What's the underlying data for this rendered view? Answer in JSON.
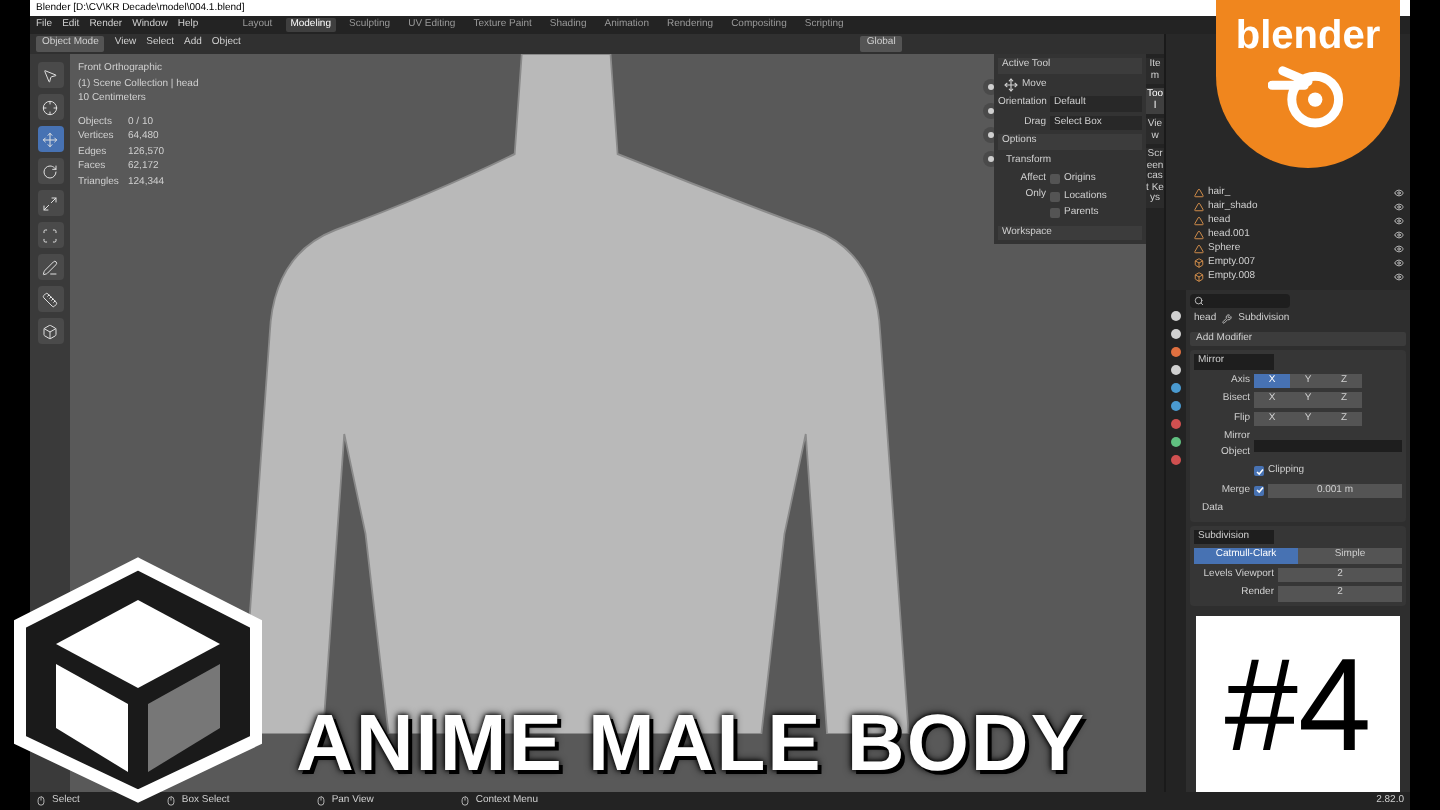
{
  "window": {
    "title": "Blender [D:\\CV\\KR Decade\\model\\004.1.blend]"
  },
  "menu": [
    "File",
    "Edit",
    "Render",
    "Window",
    "Help"
  ],
  "workspaces": [
    {
      "label": "Layout",
      "selected": false
    },
    {
      "label": "Modeling",
      "selected": true
    },
    {
      "label": "Sculpting",
      "selected": false
    },
    {
      "label": "UV Editing",
      "selected": false
    },
    {
      "label": "Texture Paint",
      "selected": false
    },
    {
      "label": "Shading",
      "selected": false
    },
    {
      "label": "Animation",
      "selected": false
    },
    {
      "label": "Rendering",
      "selected": false
    },
    {
      "label": "Compositing",
      "selected": false
    },
    {
      "label": "Scripting",
      "selected": false
    }
  ],
  "header": {
    "mode": "Object Mode",
    "menus": [
      "View",
      "Select",
      "Add",
      "Object"
    ],
    "orientation": "Global"
  },
  "viewport": {
    "info": [
      "Front Orthographic",
      "(1) Scene Collection | head",
      "10 Centimeters"
    ],
    "stats": [
      {
        "label": "Objects",
        "value": "0 / 10"
      },
      {
        "label": "Vertices",
        "value": "64,480"
      },
      {
        "label": "Edges",
        "value": "126,570"
      },
      {
        "label": "Faces",
        "value": "62,172"
      },
      {
        "label": "Triangles",
        "value": "124,344"
      }
    ]
  },
  "tools": [
    {
      "kind": "select",
      "selected": false
    },
    {
      "kind": "cursor",
      "selected": false
    },
    {
      "kind": "move",
      "selected": true
    },
    {
      "kind": "rotate",
      "selected": false
    },
    {
      "kind": "scale",
      "selected": false
    },
    {
      "kind": "transform",
      "selected": false
    },
    {
      "kind": "annotate",
      "selected": false
    },
    {
      "kind": "measure",
      "selected": false
    },
    {
      "kind": "cube",
      "selected": false
    }
  ],
  "sidebar": {
    "tabs": [
      {
        "label": "Item",
        "selected": false
      },
      {
        "label": "Tool",
        "selected": true
      },
      {
        "label": "View",
        "selected": false
      },
      {
        "label": "Screencast Keys",
        "selected": false
      }
    ],
    "active_tool": {
      "title": "Active Tool",
      "tool": "Move",
      "orientation_label": "Orientation",
      "orientation": "Default",
      "drag_label": "Drag",
      "drag": "Select Box"
    },
    "options": {
      "title": "Options",
      "transform": "Transform",
      "affect_label": "Affect Only",
      "affect": [
        {
          "label": "Origins",
          "checked": false
        },
        {
          "label": "Locations",
          "checked": false
        },
        {
          "label": "Parents",
          "checked": false
        }
      ]
    },
    "workspace": "Workspace"
  },
  "outliner": [
    {
      "name": "hair_",
      "kind": "mesh"
    },
    {
      "name": "hair_shado",
      "kind": "mesh"
    },
    {
      "name": "head",
      "kind": "mesh"
    },
    {
      "name": "head.001",
      "kind": "mesh"
    },
    {
      "name": "Sphere",
      "kind": "mesh"
    },
    {
      "name": "Empty.007",
      "kind": "empty"
    },
    {
      "name": "Empty.008",
      "kind": "empty"
    }
  ],
  "properties": {
    "breadcrumb": [
      "head",
      "Subdivision"
    ],
    "add_modifier": "Add Modifier",
    "mirror": {
      "name": "Mirror",
      "rows": [
        {
          "label": "Axis",
          "buttons": [
            {
              "label": "X",
              "selected": true
            },
            {
              "label": "Y",
              "selected": false
            },
            {
              "label": "Z",
              "selected": false
            }
          ]
        },
        {
          "label": "Bisect",
          "buttons": [
            {
              "label": "X",
              "selected": false
            },
            {
              "label": "Y",
              "selected": false
            },
            {
              "label": "Z",
              "selected": false
            }
          ]
        },
        {
          "label": "Flip",
          "buttons": [
            {
              "label": "X",
              "selected": false
            },
            {
              "label": "Y",
              "selected": false
            },
            {
              "label": "Z",
              "selected": false
            }
          ]
        }
      ],
      "mirror_object": "Mirror Object",
      "clipping": {
        "label": "Clipping",
        "checked": true
      },
      "merge": {
        "label": "Merge",
        "checked": true,
        "value": "0.001 m"
      },
      "data": "Data"
    },
    "subdivision": {
      "name": "Subdivision",
      "methods": [
        {
          "label": "Catmull-Clark",
          "selected": true
        },
        {
          "label": "Simple",
          "selected": false
        }
      ],
      "fields": [
        {
          "label": "Levels Viewport",
          "value": "2"
        },
        {
          "label": "Render",
          "value": "2"
        }
      ]
    }
  },
  "status_bar": {
    "items": [
      "Select",
      "Box Select",
      "Pan View",
      "Context Menu"
    ],
    "version": "2.82.0"
  },
  "overlay": {
    "logo": "blender",
    "title": "ANIME MALE BODY",
    "episode": "#4"
  }
}
